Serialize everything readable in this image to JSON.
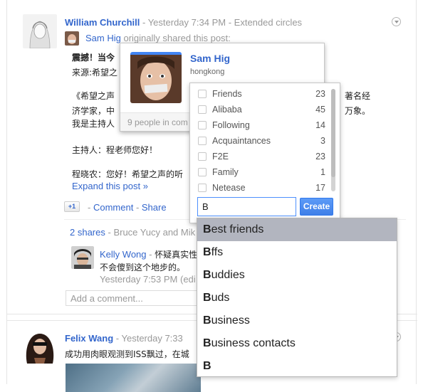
{
  "post1": {
    "author": "William Churchill",
    "separator": "-",
    "timestamp": "Yesterday 7:34 PM",
    "visibility": "Extended circles",
    "reshare": {
      "author": "Sam Hig",
      "text": "originally shared this post:"
    },
    "body_lines": [
      "震撼！当今",
      "来源:希望之",
      "《希望之声",
      "济学家，中",
      "我是主持人",
      "主持人：程老师您好！",
      "程晓农：您好！希望之声的听"
    ],
    "body_right_lines": [
      "著名经",
      "万象。"
    ],
    "expand_link": "Expand this post »",
    "plusone_label": "+1",
    "actions": {
      "comment": "Comment",
      "share": "Share"
    },
    "shares": {
      "count_label": "2 shares",
      "names": "Bruce Yucy and Mik"
    },
    "comment": {
      "author": "Kelly Wong",
      "separator": "-",
      "text_line1": "怀疑真实性",
      "text_line2": "不会傻到这个地步的。",
      "timestamp": "Yesterday 7:53 PM",
      "suffix": "(edi"
    },
    "add_comment_placeholder": "Add a comment..."
  },
  "post2": {
    "author": "Felix Wang",
    "separator": "-",
    "timestamp": "Yesterday 7:33",
    "body_line": "成功用肉眼观测到ISS飘过，在城"
  },
  "hovercard": {
    "name": "Sam Hig",
    "location": "hongkong",
    "footer": "9 people in com"
  },
  "circle_picker": {
    "circles": [
      {
        "name": "Friends",
        "count": "23"
      },
      {
        "name": "Alibaba",
        "count": "45"
      },
      {
        "name": "Following",
        "count": "14"
      },
      {
        "name": "Acquaintances",
        "count": "3"
      },
      {
        "name": "F2E",
        "count": "23"
      },
      {
        "name": "Family",
        "count": "1"
      },
      {
        "name": "Netease",
        "count": "17"
      }
    ],
    "input_value": "B",
    "create_label": "Create"
  },
  "suggestions": [
    {
      "prefix": "B",
      "rest": "est friends"
    },
    {
      "prefix": "B",
      "rest": "ffs"
    },
    {
      "prefix": "B",
      "rest": "uddies"
    },
    {
      "prefix": "B",
      "rest": "uds"
    },
    {
      "prefix": "B",
      "rest": "usiness"
    },
    {
      "prefix": "B",
      "rest": "usiness contacts"
    },
    {
      "prefix": "B",
      "rest": ""
    }
  ],
  "colors": {
    "link": "#3366cc",
    "selected_suggestion": "#b2b5bf",
    "create_button": "#4d90fe"
  }
}
